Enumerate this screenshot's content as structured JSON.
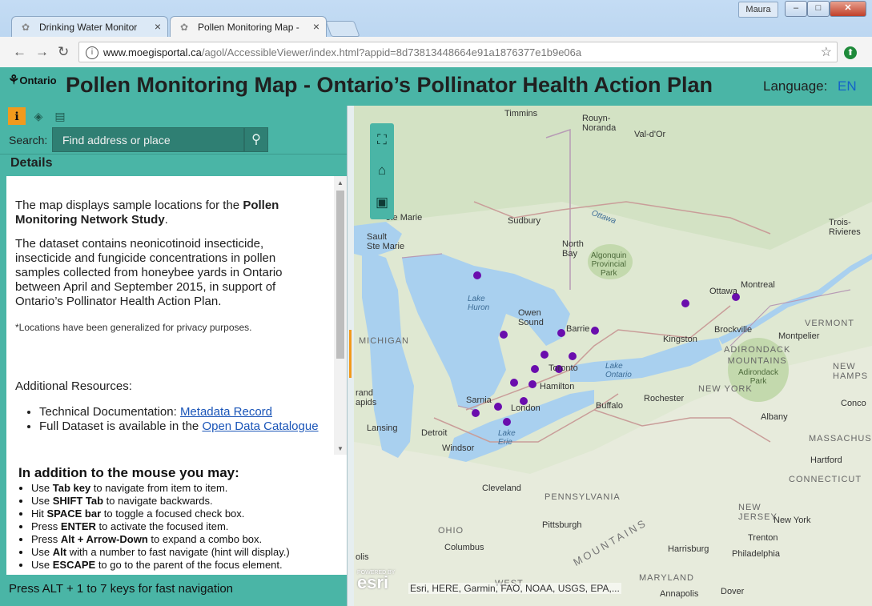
{
  "browser": {
    "tabs": [
      {
        "title": "Drinking Water Monitor",
        "active": false
      },
      {
        "title": "Pollen Monitoring Map -",
        "active": true
      }
    ],
    "user_name": "Maura",
    "url_host": "www.moegisportal.ca",
    "url_path": "/agol/AccessibleViewer/index.html?appid=8d73813448664e91a1876377e1b9e06a"
  },
  "header": {
    "logo_text": "Ontario",
    "title": "Pollen Monitoring Map - Ontario’s Pollinator Health Action Plan",
    "language_label": "Language:",
    "language_value": "EN"
  },
  "panel": {
    "search_label": "Search:",
    "search_placeholder": "Find address or place",
    "details_heading": "Details",
    "intro_prefix": "The map displays sample locations for the ",
    "intro_bold": "Pollen Monitoring Network Study",
    "intro_suffix": ".",
    "dataset_text": "The dataset contains neonicotinoid insecticide, insecticide and fungicide concentrations in pollen samples collected from honeybee yards in Ontario between April and September 2015, in support of Ontario’s Pollinator Health Action Plan.",
    "privacy_note": "*Locations have been generalized for privacy purposes.",
    "resources_heading": "Additional Resources:",
    "resources": [
      {
        "prefix": "Technical Documentation: ",
        "link": "Metadata Record"
      },
      {
        "prefix": "Full Dataset is available in the ",
        "link": "Open Data Catalogue"
      }
    ],
    "keyboard_heading": "In addition to the mouse you may:",
    "keyboard_tips": [
      {
        "pre": "Use ",
        "key": "Tab key",
        "post": " to navigate from item to item."
      },
      {
        "pre": "Use ",
        "key": "SHIFT Tab",
        "post": " to navigate backwards."
      },
      {
        "pre": "Hit ",
        "key": "SPACE bar",
        "post": " to toggle a focused check box."
      },
      {
        "pre": "Press ",
        "key": "ENTER",
        "post": " to activate the focused item."
      },
      {
        "pre": "Press ",
        "key": "Alt + Arrow-Down",
        "post": " to expand a combo box."
      },
      {
        "pre": "Use ",
        "key": "Alt",
        "post": " with a number to fast navigate (hint will display.)"
      },
      {
        "pre": "Use ",
        "key": "ESCAPE",
        "post": " to go to the parent of the focus element."
      }
    ],
    "status": "Press ALT + 1 to 7 keys for fast navigation"
  },
  "map": {
    "attribution": "Esri, HERE, Garmin, FAO, NOAA, USGS, EPA,...",
    "esri_text": "esri",
    "powered_by": "POWERED BY",
    "sample_point_color": "#6a0dad",
    "labels": {
      "timmins": "Timmins",
      "rouyn": "Rouyn-\nNoranda",
      "valdor": "Val-d'Or",
      "ste_marie": "ste Marie",
      "sault": "Sault\nSte Marie",
      "sudbury": "Sudbury",
      "north_bay": "North\nBay",
      "algonquin": "Algonquin\nProvincial\nPark",
      "ottawa_river": "Ottawa",
      "trois": "Trois-\nRivieres",
      "montreal": "Montreal",
      "ottawa": "Ottawa",
      "lake_huron": "Lake\nHuron",
      "owen_sound": "Owen\nSound",
      "barrie": "Barrie",
      "kingston": "Kingston",
      "brockville": "Brockville",
      "vermont": "VERMONT",
      "montpelier": "Montpelier",
      "michigan": "MICHIGAN",
      "adirondack": "ADIRONDACK\nMOUNTAINS",
      "adirondack_park": "Adirondack\nPark",
      "toronto": "Toronto",
      "lake_ontario": "Lake\nOntario",
      "new_hamps": "NEW\nHAMPS",
      "hamilton": "Hamilton",
      "rand": "rand\napids",
      "sarnia": "Sarnia",
      "london": "London",
      "rochester": "Rochester",
      "new_york": "NEW YORK",
      "concord": "Conco",
      "buffalo": "Buffalo",
      "albany": "Albany",
      "lansing": "Lansing",
      "detroit": "Detroit",
      "windsor": "Windsor",
      "lake_erie": "Lake\nErie",
      "massachusetts": "MASSACHUSET",
      "hartford": "Hartford",
      "connecticut": "CONNECTICUT",
      "cleveland": "Cleveland",
      "pennsylvania": "PENNSYLVANIA",
      "new_jersey": "NEW\nJERSEY",
      "ohio": "OHIO",
      "pittsburgh": "Pittsburgh",
      "new_york_city": "New York",
      "columbus": "Columbus",
      "trenton": "Trenton",
      "harrisburg": "Harrisburg",
      "philadelphia": "Philadelphia",
      "olis": "olis",
      "appalachian": "MOUNTAINS",
      "maryland": "MARYLAND",
      "west": "WEST",
      "annapolis": "Annapolis",
      "dover": "Dover"
    }
  }
}
